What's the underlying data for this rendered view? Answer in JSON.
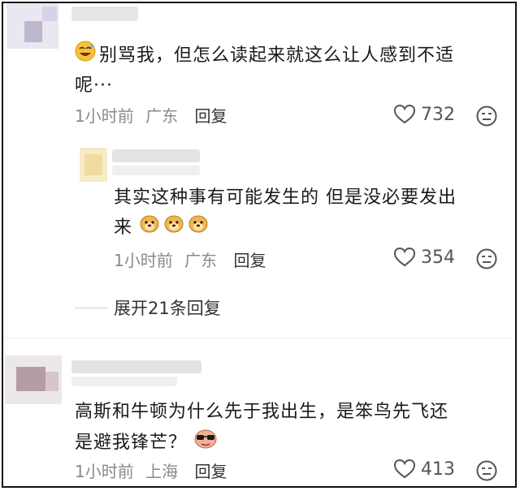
{
  "comments": [
    {
      "text_line1": "别骂我，但怎么读起来就这么让人感到不适",
      "text_line2": "呢···",
      "time": "1小时前",
      "location": "广东",
      "reply_label": "回复",
      "likes": "732"
    },
    {
      "text_line1": "其实这种事有可能发生的 但是没必要发出",
      "text_line2": "来",
      "time": "1小时前",
      "location": "广东",
      "reply_label": "回复",
      "likes": "354"
    },
    {
      "text_line1": "高斯和牛顿为什么先于我出生，是笨鸟先飞还",
      "text_line2": "是避我锋芒？",
      "time": "1小时前",
      "location": "上海",
      "reply_label": "回复",
      "likes": "413"
    }
  ],
  "expand_replies": "展开21条回复",
  "icons": {
    "sweat_smile": "grinning-sweat-emoji",
    "dog_face": "dog-emoji",
    "cool_face": "sunglasses-emoji",
    "like": "heart-icon",
    "dislike": "sad-face-icon"
  }
}
